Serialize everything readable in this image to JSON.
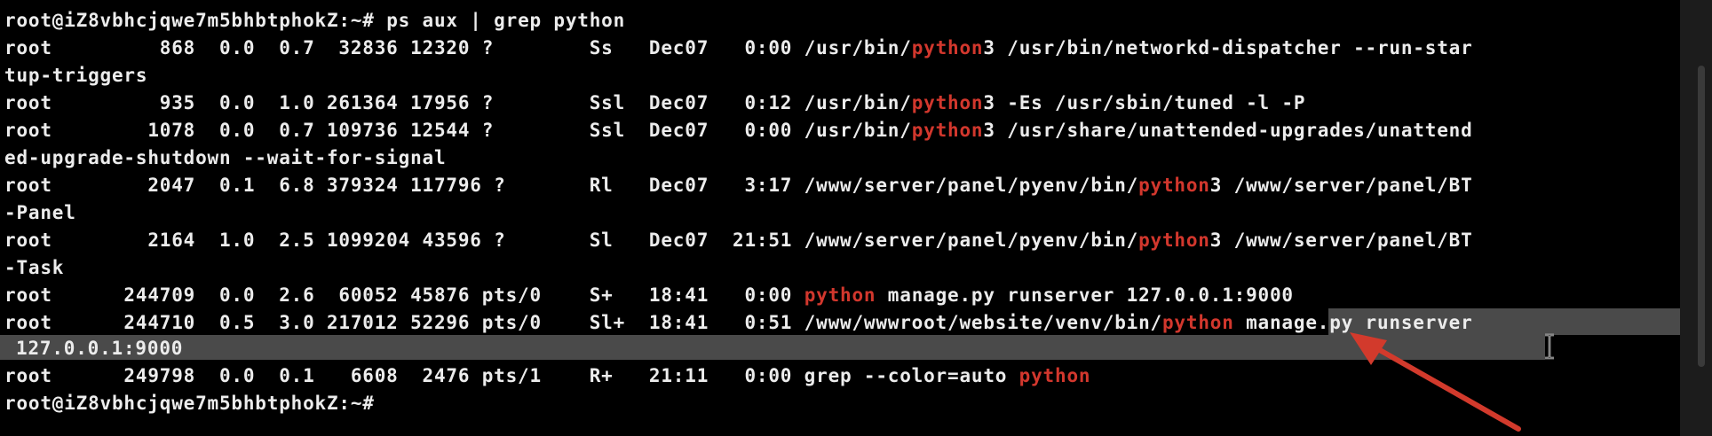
{
  "prompt": "root@iZ8vbhcjqwe7m5bhbtphokZ:~#",
  "command": " ps aux | grep python",
  "highlight_color": "#d2372d",
  "rows": [
    {
      "pre": "root         868  0.0  0.7  32836 12320 ?        Ss   Dec07   0:00 /usr/bin/",
      "hl": "python",
      "post": "3 /usr/bin/networkd-dispatcher --run-star"
    },
    {
      "pre": "tup-triggers",
      "hl": "",
      "post": ""
    },
    {
      "pre": "root         935  0.0  1.0 261364 17956 ?        Ssl  Dec07   0:12 /usr/bin/",
      "hl": "python",
      "post": "3 -Es /usr/sbin/tuned -l -P"
    },
    {
      "pre": "root        1078  0.0  0.7 109736 12544 ?        Ssl  Dec07   0:00 /usr/bin/",
      "hl": "python",
      "post": "3 /usr/share/unattended-upgrades/unattend"
    },
    {
      "pre": "ed-upgrade-shutdown --wait-for-signal",
      "hl": "",
      "post": ""
    },
    {
      "pre": "root        2047  0.1  6.8 379324 117796 ?       Rl   Dec07   3:17 /www/server/panel/pyenv/bin/",
      "hl": "python",
      "post": "3 /www/server/panel/BT"
    },
    {
      "pre": "-Panel",
      "hl": "",
      "post": ""
    },
    {
      "pre": "root        2164  1.0  2.5 1099204 43596 ?       Sl   Dec07  21:51 /www/server/panel/pyenv/bin/",
      "hl": "python",
      "post": "3 /www/server/panel/BT"
    },
    {
      "pre": "-Task",
      "hl": "",
      "post": ""
    },
    {
      "pre": "root      244709  0.0  2.6  60052 45876 pts/0    S+   18:41   0:00 ",
      "hl": "python",
      "post": " manage.py runserver 127.0.0.1:9000"
    },
    {
      "pre": "root      244710  0.5  3.0 217012 52296 pts/0    Sl+  18:41   0:51 /www/wwwroot/website/venv/bin/",
      "hl": "python",
      "post": " manage.py runserver"
    },
    {
      "pre": "127.0.0.1:9000",
      "hl": "",
      "post": ""
    },
    {
      "pre": "root      249798  0.0  0.1   6608  2476 pts/1    R+   21:11   0:00 grep --color=auto ",
      "hl": "python",
      "post": ""
    }
  ],
  "final_prompt": "root@iZ8vbhcjqwe7m5bhbtphokZ:~#"
}
